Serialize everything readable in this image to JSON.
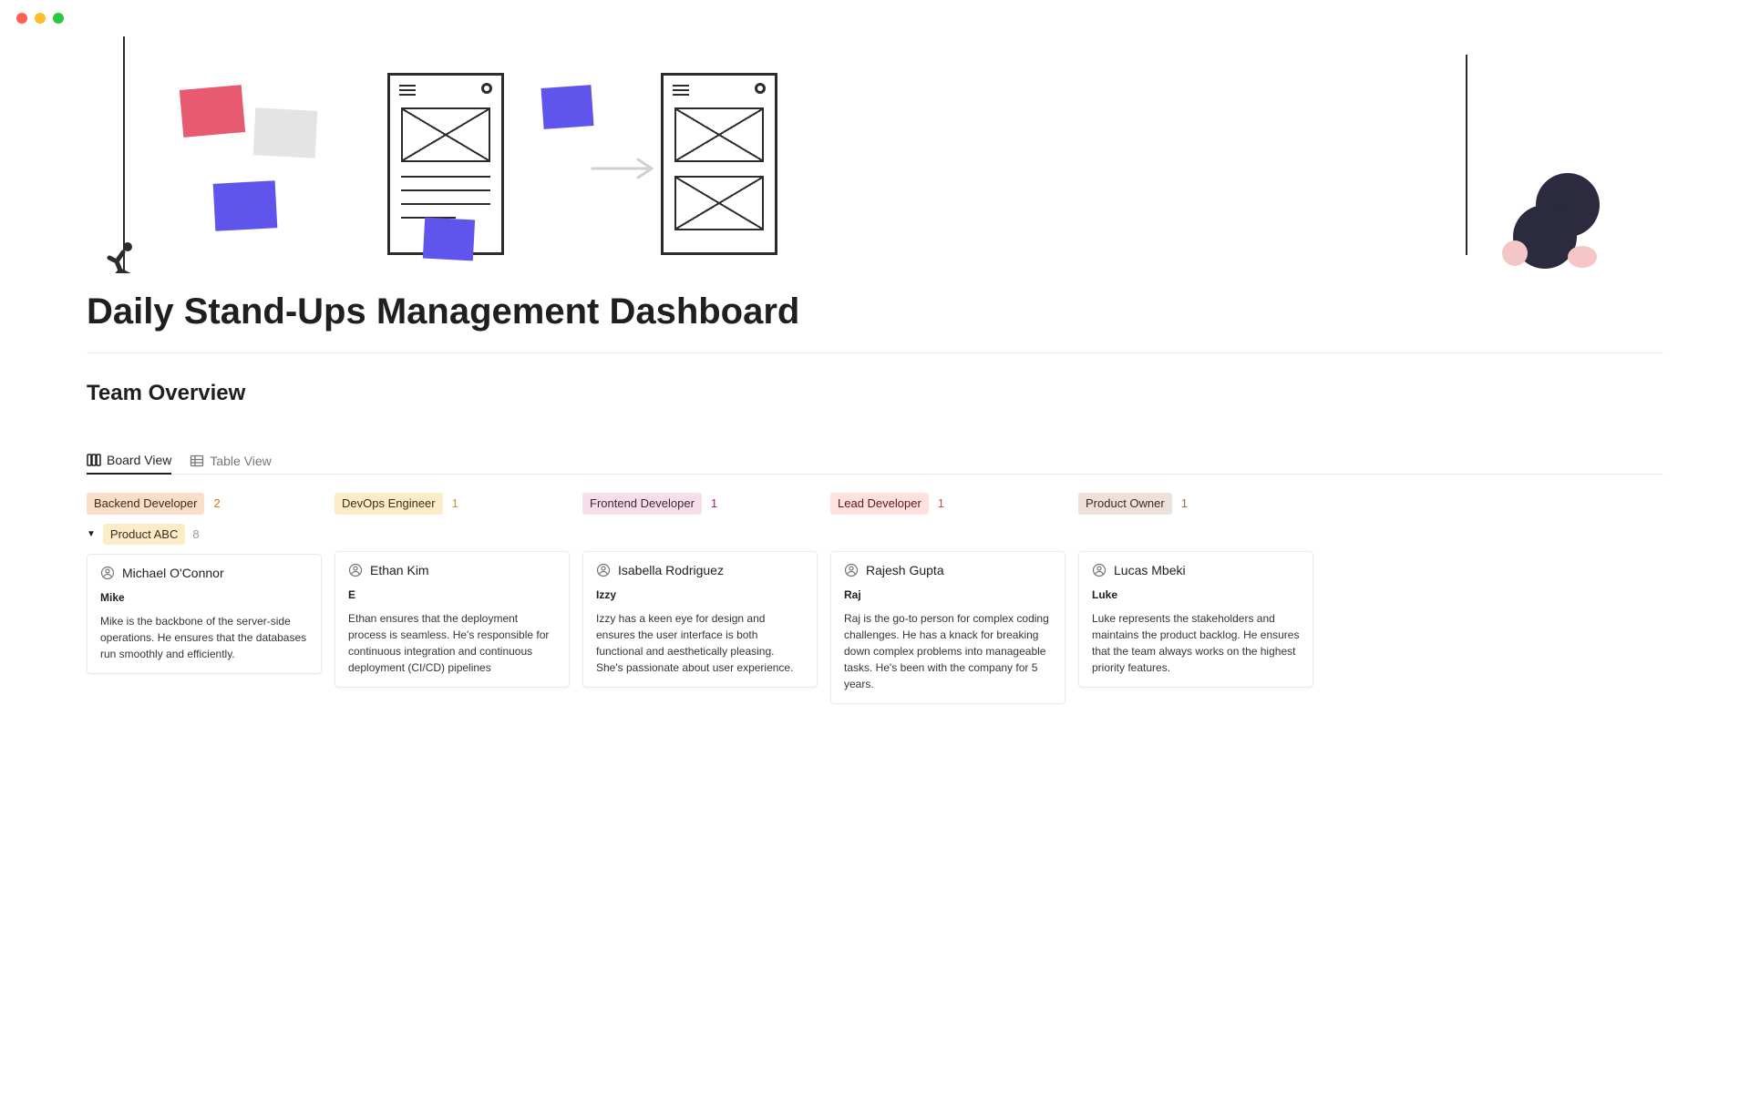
{
  "page": {
    "title": "Daily Stand-Ups Management Dashboard",
    "section_title": "Team Overview"
  },
  "views": {
    "board": "Board View",
    "table": "Table View"
  },
  "group": {
    "name": "Product ABC",
    "count": "8"
  },
  "columns": [
    {
      "label": "Backend Developer",
      "count": "2",
      "tag_class": "tag-orange",
      "count_class": "count-orange",
      "card": {
        "name": "Michael O'Connor",
        "nickname": "Mike",
        "desc": "Mike is the backbone of the server-side operations. He ensures that the databases run smoothly and efficiently."
      }
    },
    {
      "label": "DevOps Engineer",
      "count": "1",
      "tag_class": "tag-yellow",
      "count_class": "count-yellow",
      "card": {
        "name": "Ethan Kim",
        "nickname": "E",
        "desc": "Ethan ensures that the deployment process is seamless. He's responsible for continuous integration and continuous deployment (CI/CD) pipelines"
      }
    },
    {
      "label": "Frontend Developer",
      "count": "1",
      "tag_class": "tag-pink",
      "count_class": "count-pink",
      "card": {
        "name": "Isabella Rodriguez",
        "nickname": "Izzy",
        "desc": "Izzy has a keen eye for design and ensures the user interface is both functional and aesthetically pleasing. She's passionate about user experience."
      }
    },
    {
      "label": "Lead Developer",
      "count": "1",
      "tag_class": "tag-red",
      "count_class": "count-red",
      "card": {
        "name": "Rajesh Gupta",
        "nickname": "Raj",
        "desc": "Raj is the go-to person for complex coding challenges. He has a knack for breaking down complex problems into manageable tasks. He's been with the company for 5 years."
      }
    },
    {
      "label": "Product Owner",
      "count": "1",
      "tag_class": "tag-brown",
      "count_class": "count-brown",
      "card": {
        "name": "Lucas Mbeki",
        "nickname": "Luke",
        "desc": "Luke represents the stakeholders and maintains the product backlog. He ensures that the team always works on the highest priority features."
      }
    }
  ]
}
